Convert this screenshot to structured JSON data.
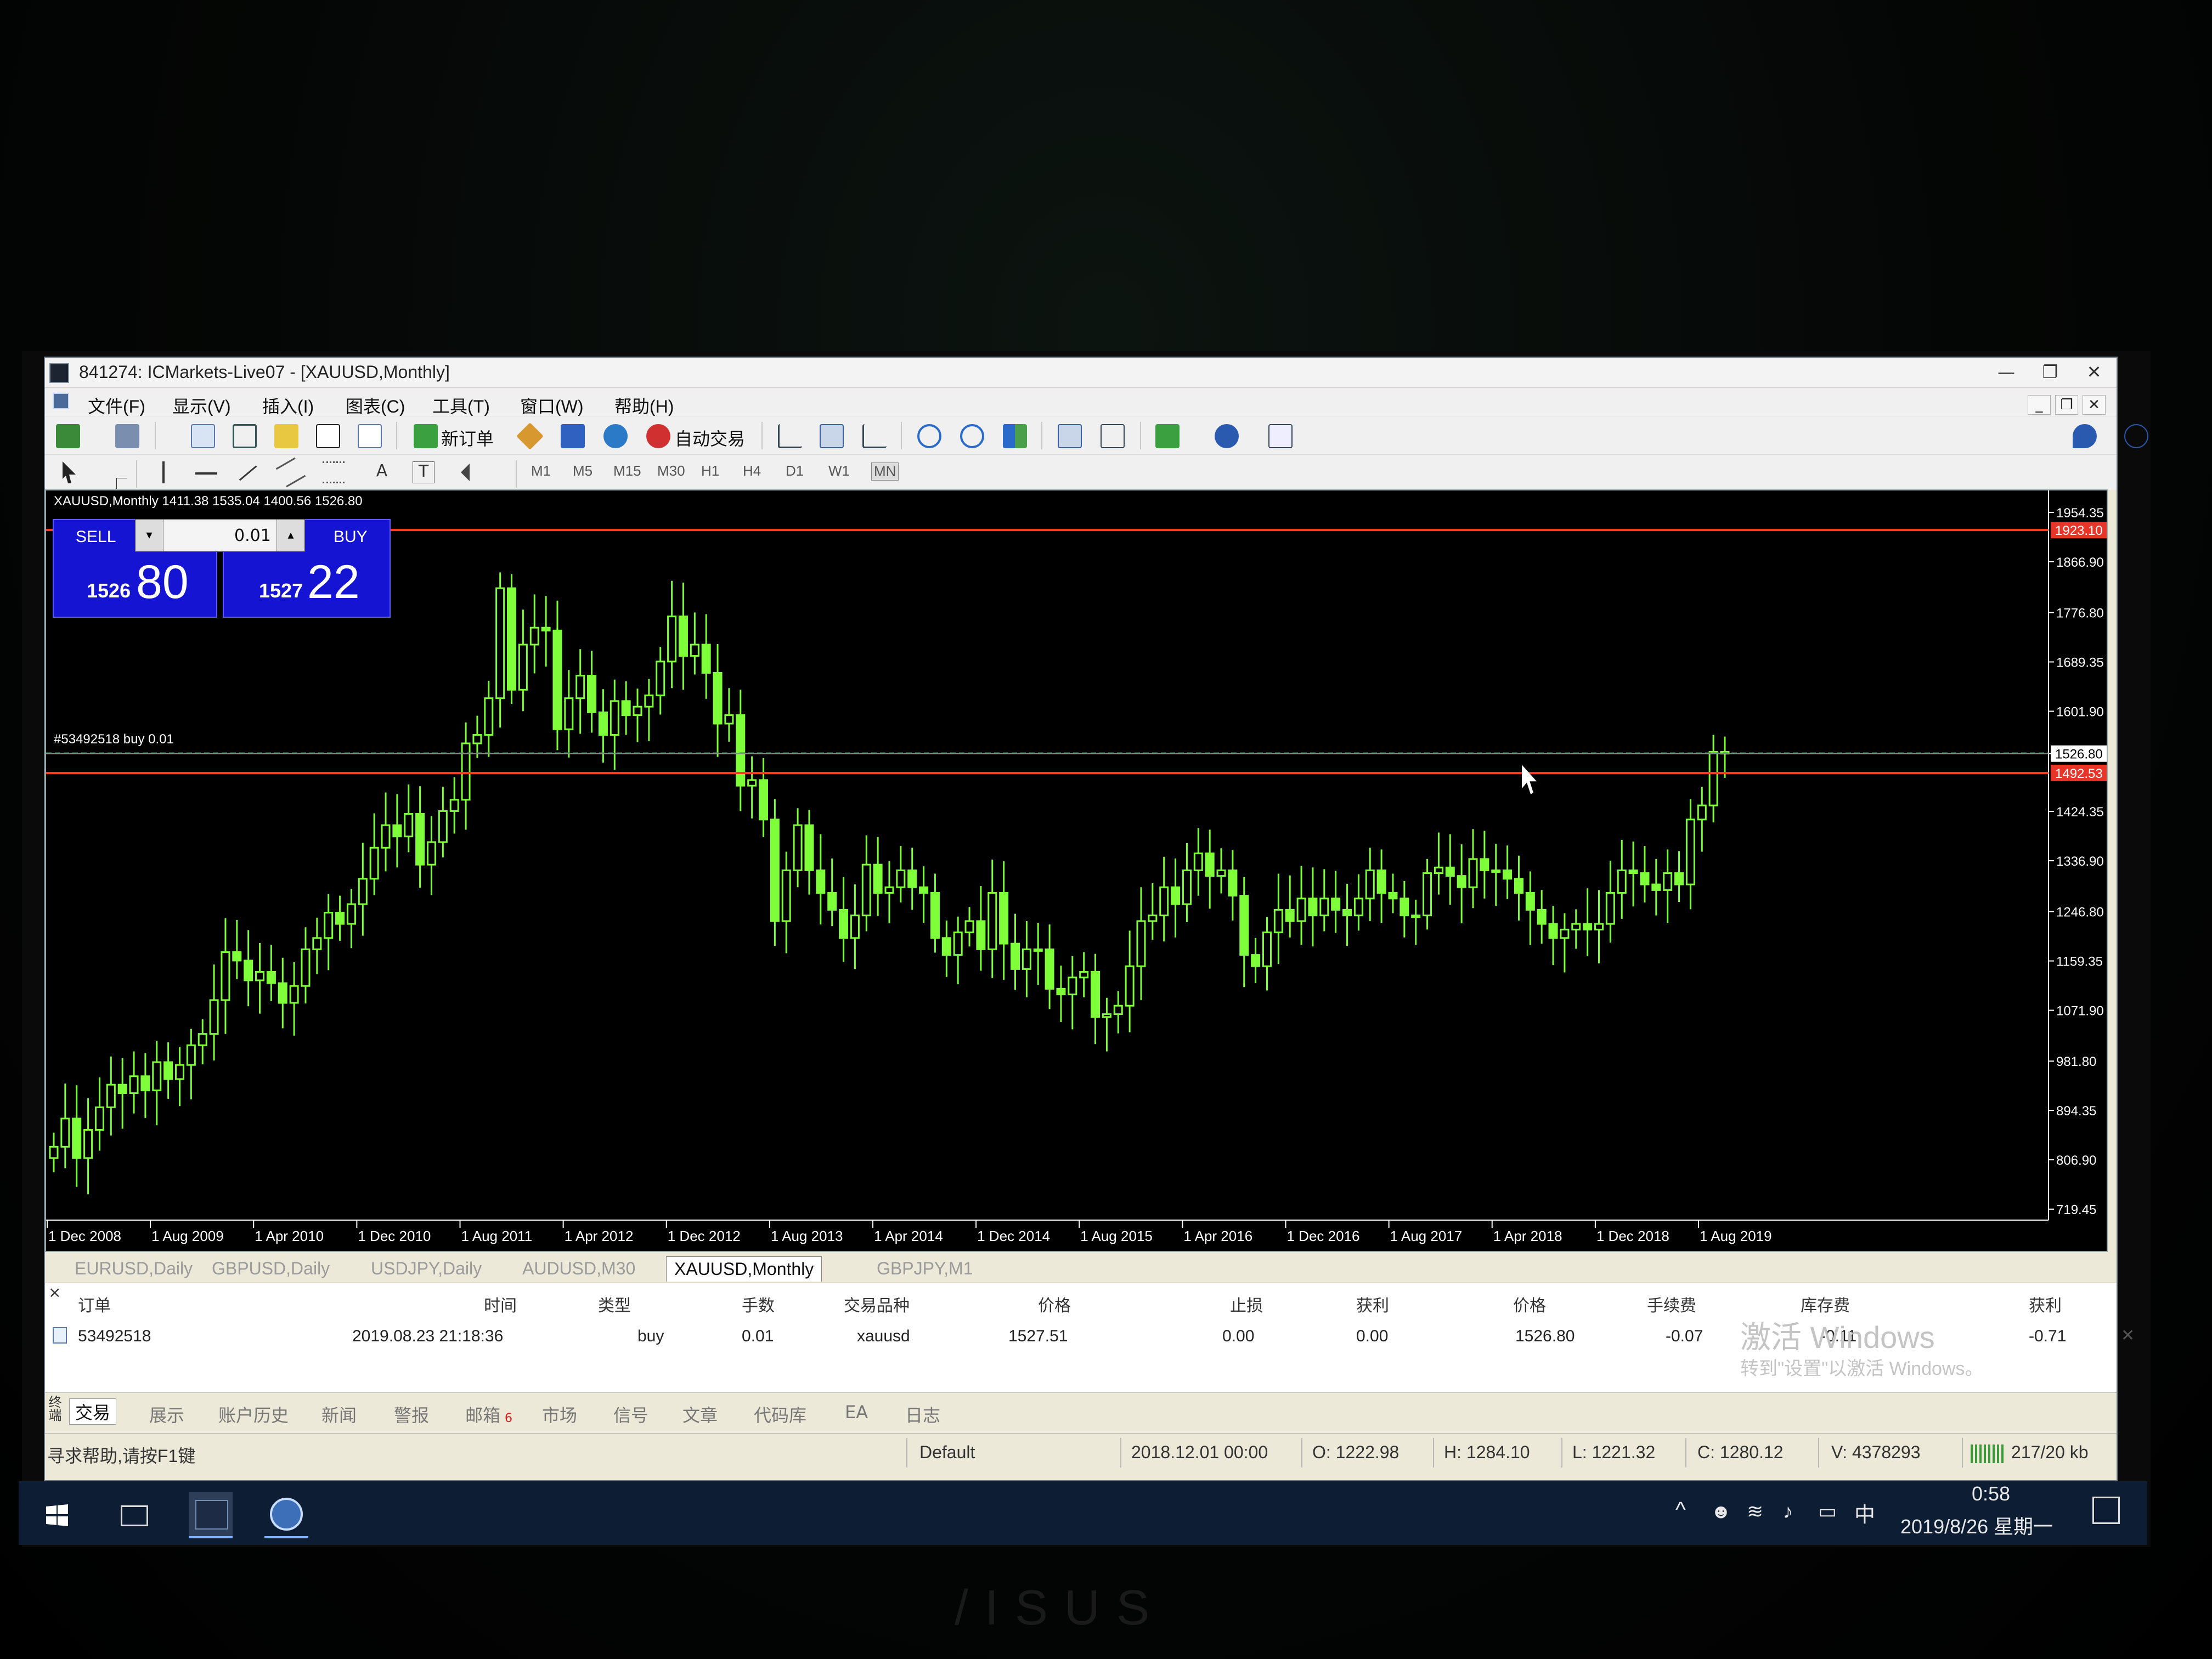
{
  "window": {
    "title": "841274: ICMarkets-Live07 - [XAUUSD,Monthly]",
    "minimize": "—",
    "restore": "❐",
    "close": "✕",
    "mdi_min": "_",
    "mdi_restore": "❐",
    "mdi_close": "✕"
  },
  "menu": [
    "文件(F)",
    "显示(V)",
    "插入(I)",
    "图表(C)",
    "工具(T)",
    "窗口(W)",
    "帮助(H)"
  ],
  "toolbar": {
    "new_order": "新订单",
    "auto_trade": "自动交易",
    "timeframes": [
      "M1",
      "M5",
      "M15",
      "M30",
      "H1",
      "H4",
      "D1",
      "W1",
      "MN"
    ],
    "active_timeframe": "MN",
    "text_tool": "A",
    "text_label_tool": "T"
  },
  "chart": {
    "header": "XAUUSD,Monthly  1411.38 1535.04 1400.56 1526.80",
    "order_line_label": "#53492518 buy 0.01",
    "one_click": {
      "sell_label": "SELL",
      "buy_label": "BUY",
      "lot": "0.01",
      "sell_big": "1526",
      "sell_small": "80",
      "buy_big": "1527",
      "buy_small": "22"
    },
    "bg_color": "#000000",
    "candle_color": "#7fff3a",
    "line_color": "#ff3b1f",
    "order_line_color": "#2f8f4f"
  },
  "chart_data": {
    "type": "candlestick",
    "symbol": "XAUUSD",
    "timeframe": "Monthly",
    "ylim": [
      719.45,
      1954.35
    ],
    "y_ticks": [
      "1954.35",
      "1866.90",
      "1776.80",
      "1689.35",
      "1601.90",
      "1526.80",
      "1424.35",
      "1336.90",
      "1246.80",
      "1159.35",
      "1071.90",
      "981.80",
      "894.35",
      "806.90",
      "719.45"
    ],
    "x_ticks": [
      "1 Dec 2008",
      "1 Aug 2009",
      "1 Apr 2010",
      "1 Dec 2010",
      "1 Aug 2011",
      "1 Apr 2012",
      "1 Dec 2012",
      "1 Aug 2013",
      "1 Apr 2014",
      "1 Dec 2014",
      "1 Aug 2015",
      "1 Apr 2016",
      "1 Dec 2016",
      "1 Aug 2017",
      "1 Apr 2018",
      "1 Dec 2018",
      "1 Aug 2019"
    ],
    "start_month": "2008-08",
    "closes": [
      830,
      880,
      810,
      860,
      900,
      940,
      925,
      955,
      930,
      980,
      950,
      975,
      1010,
      1030,
      1090,
      1175,
      1160,
      1125,
      1140,
      1120,
      1085,
      1115,
      1180,
      1200,
      1245,
      1225,
      1260,
      1305,
      1360,
      1400,
      1380,
      1420,
      1330,
      1370,
      1425,
      1445,
      1545,
      1560,
      1625,
      1820,
      1640,
      1720,
      1750,
      1745,
      1570,
      1625,
      1665,
      1600,
      1560,
      1620,
      1595,
      1610,
      1630,
      1690,
      1770,
      1700,
      1720,
      1670,
      1580,
      1595,
      1470,
      1480,
      1410,
      1230,
      1320,
      1400,
      1320,
      1280,
      1250,
      1200,
      1240,
      1330,
      1280,
      1290,
      1320,
      1290,
      1280,
      1200,
      1170,
      1210,
      1230,
      1180,
      1280,
      1190,
      1145,
      1180,
      1180,
      1110,
      1100,
      1130,
      1140,
      1060,
      1065,
      1080,
      1150,
      1230,
      1240,
      1290,
      1260,
      1320,
      1350,
      1310,
      1320,
      1275,
      1170,
      1150,
      1210,
      1250,
      1230,
      1270,
      1240,
      1270,
      1250,
      1240,
      1270,
      1320,
      1280,
      1270,
      1240,
      1240,
      1315,
      1325,
      1310,
      1290,
      1340,
      1320,
      1320,
      1305,
      1280,
      1250,
      1225,
      1200,
      1215,
      1225,
      1215,
      1225,
      1280,
      1320,
      1315,
      1295,
      1285,
      1315,
      1295,
      1410,
      1435,
      1530,
      1526.8
    ],
    "horizontal_lines": [
      1923.1,
      1492.53
    ],
    "current_price": 1526.8,
    "order_price": 1527.51,
    "price_tags": [
      "1923.10",
      "1526.80",
      "1492.53"
    ]
  },
  "symbol_tabs": [
    "EURUSD,Daily",
    "GBPUSD,Daily",
    "USDJPY,Daily",
    "AUDUSD,M30",
    "XAUUSD,Monthly",
    "GBPJPY,M1"
  ],
  "active_symbol_tab": "XAUUSD,Monthly",
  "terminal": {
    "side_label": "终端",
    "headers": [
      "订单",
      "时间",
      "类型",
      "手数",
      "交易品种",
      "价格",
      "止损",
      "获利",
      "价格",
      "手续费",
      "库存费",
      "获利"
    ],
    "row": [
      "53492518",
      "2019.08.23 21:18:36",
      "buy",
      "0.01",
      "xauusd",
      "1527.51",
      "0.00",
      "0.00",
      "1526.80",
      "-0.07",
      "-0.11",
      "-0.71"
    ],
    "tabs": [
      "交易",
      "展示",
      "账户历史",
      "新闻",
      "警报",
      "邮箱",
      "市场",
      "信号",
      "文章",
      "代码库",
      "EA",
      "日志"
    ],
    "active_tab": "交易",
    "mail_badge": "6",
    "watermark_1": "激活 Windows",
    "watermark_2": "转到\"设置\"以激活 Windows。"
  },
  "statusbar": {
    "help": "寻求帮助,请按F1键",
    "profile": "Default",
    "datetime": "2018.12.01 00:00",
    "open": "O: 1222.98",
    "high": "H: 1284.10",
    "low": "L: 1221.32",
    "close": "C: 1280.12",
    "volume": "V: 4378293",
    "traffic": "217/20 kb"
  },
  "taskbar": {
    "time": "0:58",
    "date": "2019/8/26 星期一",
    "ime": "中"
  }
}
